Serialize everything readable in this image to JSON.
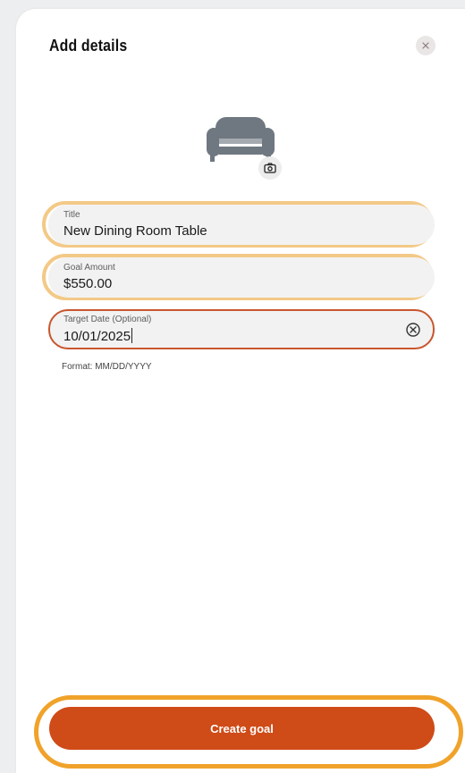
{
  "dialog": {
    "title": "Add details",
    "close_label": "×"
  },
  "image": {
    "icon": "sofa-icon",
    "camera_icon": "camera-icon"
  },
  "fields": {
    "title": {
      "label": "Title",
      "value": "New Dining Room Table"
    },
    "goal_amount": {
      "label": "Goal Amount",
      "value": "$550.00"
    },
    "target_date": {
      "label": "Target Date (Optional)",
      "value": "10/01/2025",
      "helper": "Format: MM/DD/YYYY"
    }
  },
  "actions": {
    "create_label": "Create goal"
  },
  "colors": {
    "accent": "#cf4b18",
    "highlight_ring": "#f3c987",
    "cta_ring": "#f0a22a",
    "error_border": "#c9562d"
  }
}
